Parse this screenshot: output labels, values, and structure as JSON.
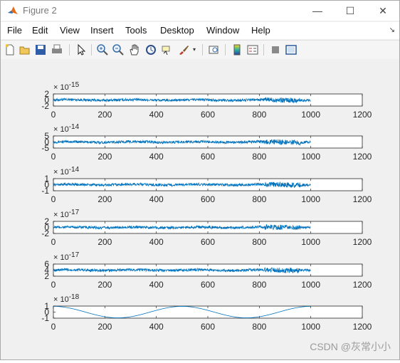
{
  "window": {
    "title": "Figure 2",
    "controls": {
      "minimize": "—",
      "maximize": "☐",
      "close": "✕"
    }
  },
  "menu": [
    "File",
    "Edit",
    "View",
    "Insert",
    "Tools",
    "Desktop",
    "Window",
    "Help"
  ],
  "menu_arrow": "↘",
  "toolbar": [
    "new-figure-icon",
    "open-file-icon",
    "save-icon",
    "print-icon",
    "edit-plot-arrow-icon",
    "zoom-in-icon",
    "zoom-out-icon",
    "pan-hand-icon",
    "rotate-3d-icon",
    "data-cursor-icon",
    "brush-icon",
    "link-plot-icon",
    "colorbar-icon",
    "legend-icon",
    "hide-plot-tools-icon",
    "show-plot-tools-icon"
  ],
  "colors": {
    "line": "#0072bd",
    "axes_bg": "#ffffff",
    "figure_bg": "#f0f0f0"
  },
  "chart_data": [
    {
      "type": "line",
      "exponent": "× 10",
      "power": "-15",
      "yticks": [
        "2",
        "0",
        "-2"
      ],
      "xticks": [
        "0",
        "200",
        "400",
        "600",
        "800",
        "1000",
        "1200"
      ],
      "xlim": [
        0,
        1200
      ],
      "ylim": [
        -2,
        2
      ],
      "n_points": 1000,
      "shape": "noise"
    },
    {
      "type": "line",
      "exponent": "× 10",
      "power": "-14",
      "yticks": [
        "5",
        "0",
        "-5"
      ],
      "xticks": [
        "0",
        "200",
        "400",
        "600",
        "800",
        "1000",
        "1200"
      ],
      "xlim": [
        0,
        1200
      ],
      "ylim": [
        -5,
        5
      ],
      "n_points": 1000,
      "shape": "noise"
    },
    {
      "type": "line",
      "exponent": "× 10",
      "power": "-14",
      "yticks": [
        "1",
        "0",
        "-1"
      ],
      "xticks": [
        "0",
        "200",
        "400",
        "600",
        "800",
        "1000",
        "1200"
      ],
      "xlim": [
        0,
        1200
      ],
      "ylim": [
        -1,
        1
      ],
      "n_points": 1000,
      "shape": "noise"
    },
    {
      "type": "line",
      "exponent": "× 10",
      "power": "-17",
      "yticks": [
        "2",
        "0",
        "-2"
      ],
      "xticks": [
        "0",
        "200",
        "400",
        "600",
        "800",
        "1000",
        "1200"
      ],
      "xlim": [
        0,
        1200
      ],
      "ylim": [
        -2,
        2
      ],
      "n_points": 1000,
      "shape": "noise"
    },
    {
      "type": "line",
      "exponent": "× 10",
      "power": "-17",
      "yticks": [
        "6",
        "4",
        "2"
      ],
      "xticks": [
        "0",
        "200",
        "400",
        "600",
        "800",
        "1000",
        "1200"
      ],
      "xlim": [
        0,
        1200
      ],
      "ylim": [
        2,
        6
      ],
      "n_points": 1000,
      "shape": "noise"
    },
    {
      "type": "line",
      "exponent": "× 10",
      "power": "-18",
      "yticks": [
        "1",
        "0",
        "-1"
      ],
      "xticks": [
        "0",
        "200",
        "400",
        "600",
        "800",
        "1000",
        "1200"
      ],
      "xlim": [
        0,
        1200
      ],
      "ylim": [
        -1,
        1
      ],
      "n_points": 1000,
      "shape": "cosine"
    }
  ],
  "watermark": "CSDN @灰常小小"
}
